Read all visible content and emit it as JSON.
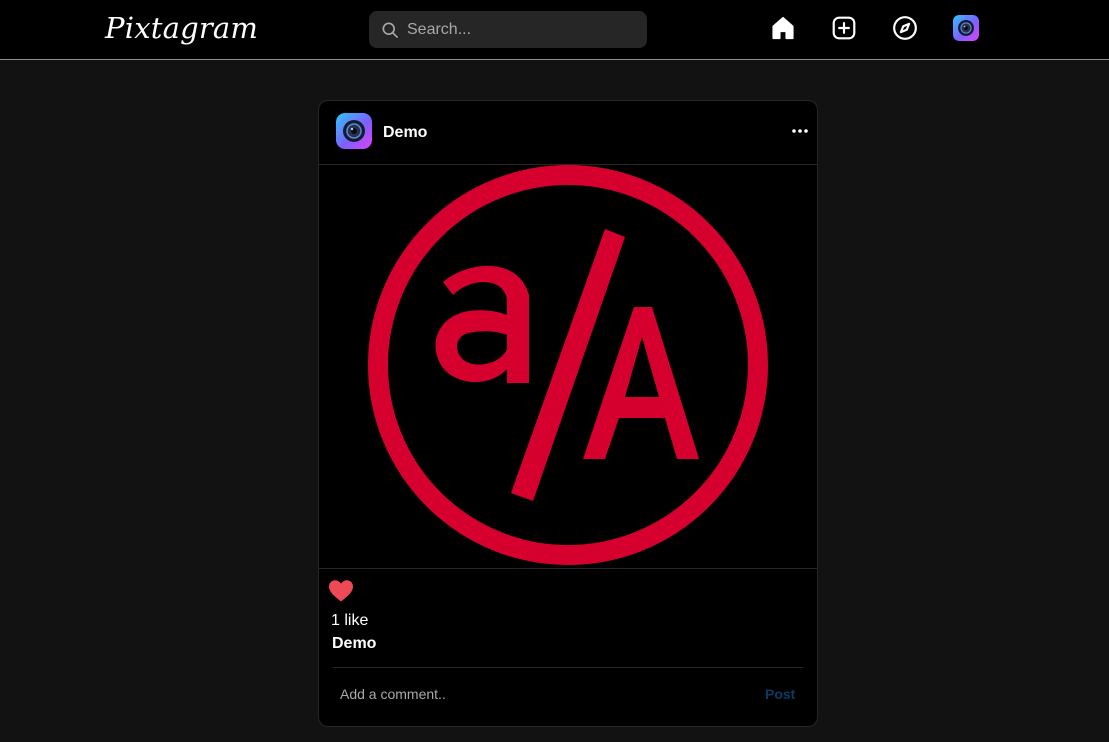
{
  "app": {
    "logo_text": "Pixtagram"
  },
  "search": {
    "placeholder": "Search...",
    "icon": "search-icon"
  },
  "nav": {
    "items": [
      {
        "icon": "home-icon"
      },
      {
        "icon": "plus-square-icon"
      },
      {
        "icon": "compass-icon"
      },
      {
        "icon": "avatar"
      }
    ]
  },
  "post": {
    "username": "Demo",
    "more_icon": "more-horizontal-icon",
    "image_desc_icon": "aa-logo-image",
    "likes_text": "1 like",
    "caption_user": "Demo",
    "liked": true
  },
  "comment": {
    "placeholder": "Add a comment..",
    "post_label": "Post"
  },
  "colors": {
    "background": "#121212",
    "topbar": "#000000",
    "card": "#000000",
    "search_bg": "#262626",
    "accent_red": "#d6002f",
    "heart": "#ed4956",
    "post_button": "#0a3a62"
  }
}
